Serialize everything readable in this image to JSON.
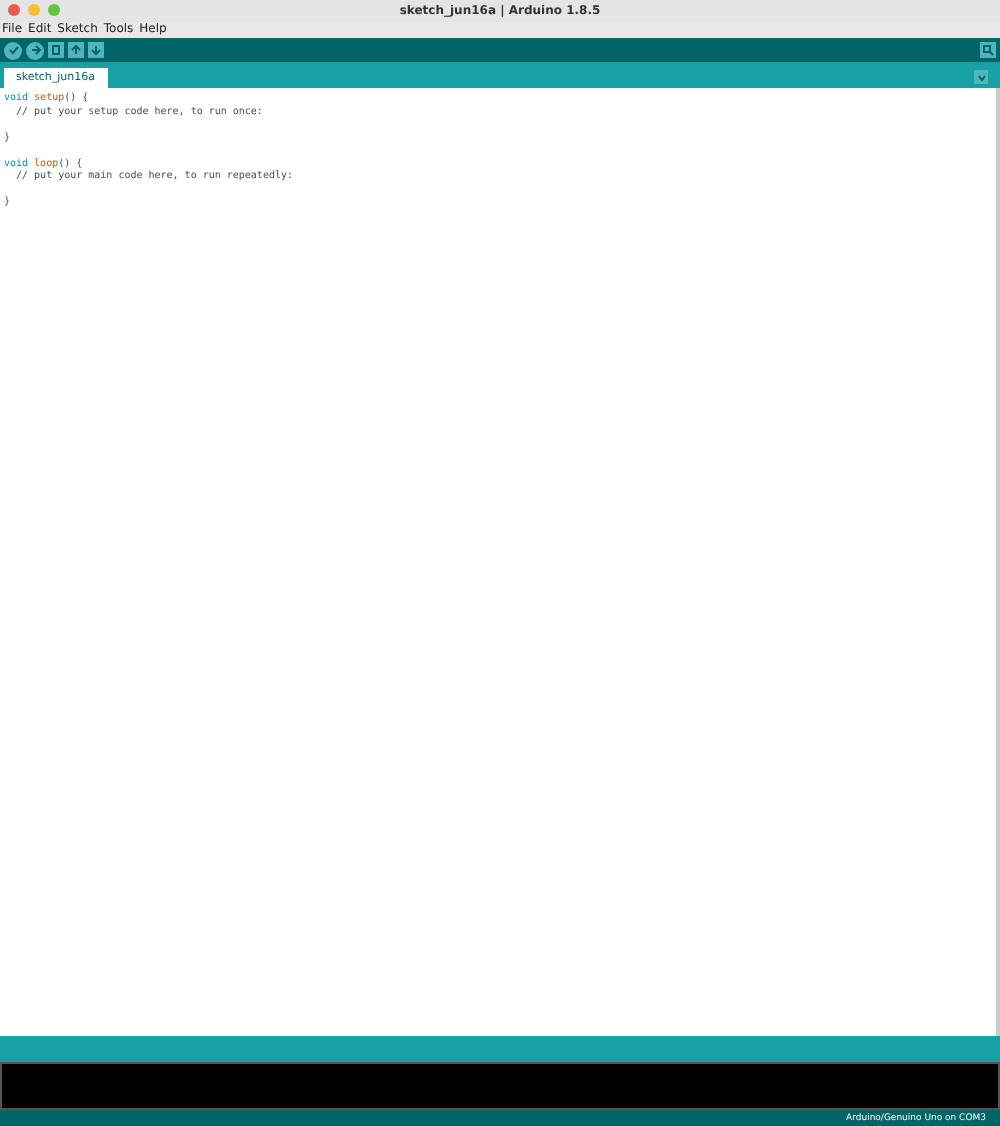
{
  "window": {
    "title": "sketch_jun16a | Arduino 1.8.5"
  },
  "menu": [
    "File",
    "Edit",
    "Sketch",
    "Tools",
    "Help"
  ],
  "tabs": [
    {
      "label": "sketch_jun16a",
      "selected": true
    }
  ],
  "code": [
    {
      "space_before": false,
      "tokens": [
        {
          "kind": "keyword",
          "text": "void"
        },
        {
          "kind": "function",
          "text": "setup"
        },
        {
          "kind": "plain",
          "text": "() {"
        }
      ]
    },
    {
      "space_before": false,
      "tokens": [
        {
          "kind": "comment",
          "text": "  // put your setup code here, to run once:"
        }
      ]
    },
    {
      "space_before": true,
      "tokens": [
        {
          "kind": "plain",
          "text": "}"
        }
      ]
    },
    {
      "space_before": true,
      "tokens": [
        {
          "kind": "keyword",
          "text": "void"
        },
        {
          "kind": "function",
          "text": "loop"
        },
        {
          "kind": "plain",
          "text": "() {"
        }
      ]
    },
    {
      "space_before": false,
      "tokens": [
        {
          "kind": "comment",
          "text": "  // put your main code here, to run repeatedly:"
        }
      ]
    },
    {
      "space_before": true,
      "tokens": [
        {
          "kind": "plain",
          "text": "}"
        }
      ]
    }
  ],
  "status_bar": "Arduino/Genuino Uno on COM3"
}
